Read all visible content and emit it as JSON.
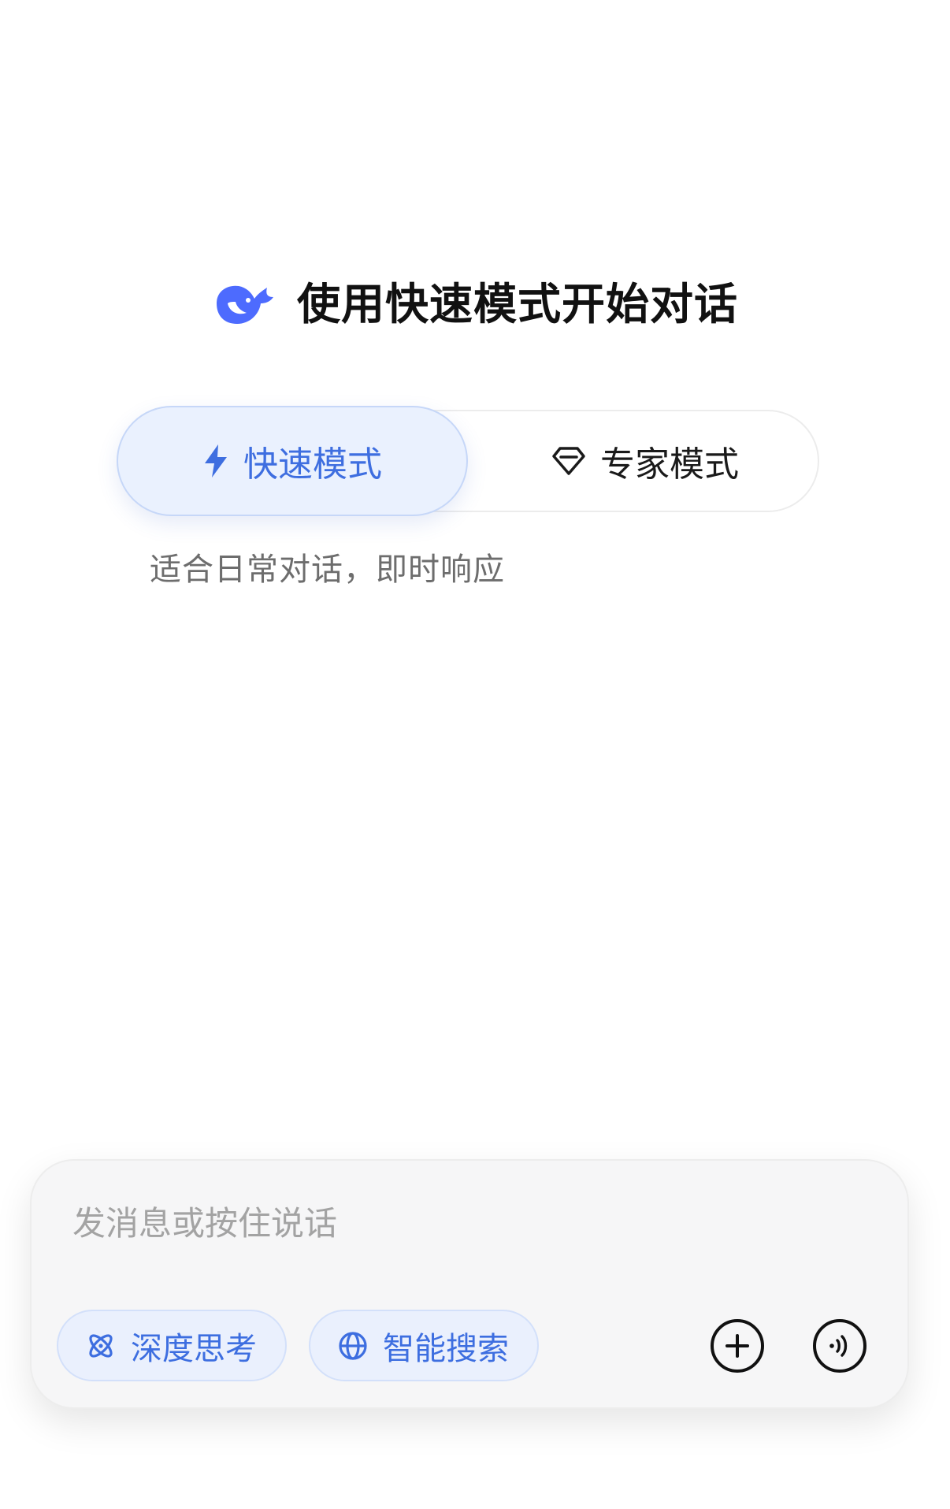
{
  "header": {
    "title": "使用快速模式开始对话",
    "logo_icon": "deepseek-whale-icon",
    "brand_color": "#4d6bfe"
  },
  "modes": {
    "fast": {
      "label": "快速模式",
      "icon": "lightning-bolt-icon",
      "selected": true
    },
    "expert": {
      "label": "专家模式",
      "icon": "diamond-icon",
      "selected": false
    },
    "description": "适合日常对话，即时响应"
  },
  "composer": {
    "placeholder": "发消息或按住说话",
    "value": "",
    "chips": {
      "deep_think": {
        "label": "深度思考",
        "icon": "atom-icon"
      },
      "smart_search": {
        "label": "智能搜索",
        "icon": "globe-icon"
      }
    },
    "add_icon": "plus-circle-icon",
    "voice_icon": "voice-wave-icon"
  },
  "colors": {
    "accent": "#3e6ee0",
    "accent_bg": "#eaf1fe",
    "muted_text": "#6d6d6d",
    "placeholder": "#a3a3a3"
  }
}
